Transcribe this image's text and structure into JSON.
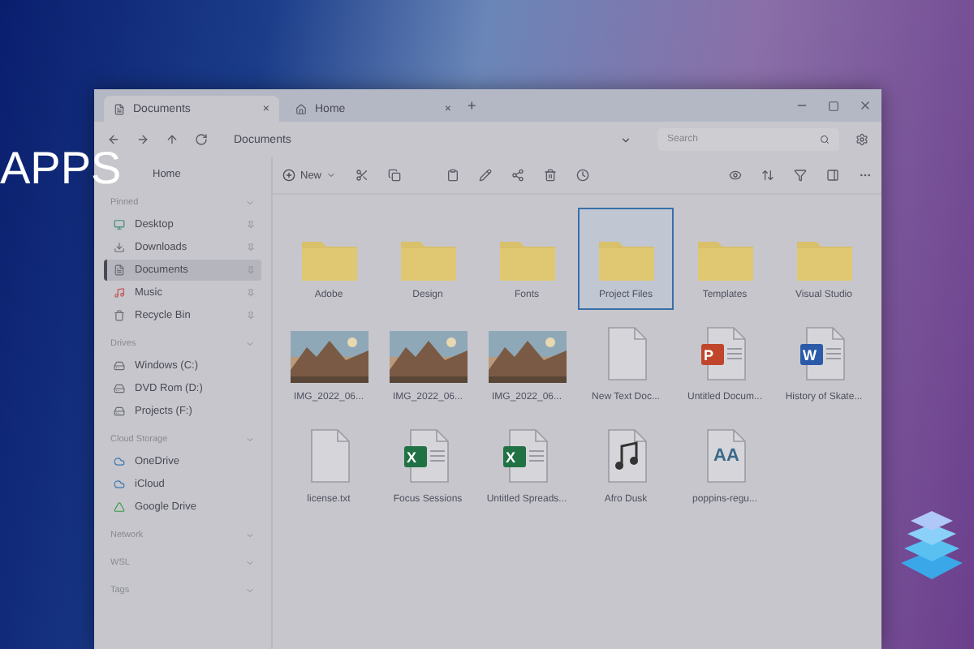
{
  "overlay": {
    "title": "APPS"
  },
  "tabs": [
    {
      "label": "Documents",
      "selected": true,
      "close": "×"
    },
    {
      "label": "Home",
      "selected": false,
      "close": "×"
    }
  ],
  "new_tab": "+",
  "address": {
    "path": "Documents",
    "search_placeholder": "Search"
  },
  "toolbar": {
    "new_label": "New"
  },
  "sidebar": [
    {
      "kind": "item",
      "label": "Home",
      "selected": false
    },
    {
      "kind": "section",
      "label": "Pinned"
    },
    {
      "kind": "item",
      "label": "Desktop",
      "selected": false,
      "pinned": true
    },
    {
      "kind": "item",
      "label": "Downloads",
      "selected": false,
      "pinned": true
    },
    {
      "kind": "item",
      "label": "Documents",
      "selected": true,
      "pinned": true
    },
    {
      "kind": "item",
      "label": "Music",
      "selected": false,
      "pinned": true
    },
    {
      "kind": "item",
      "label": "Recycle Bin",
      "selected": false,
      "pinned": true
    },
    {
      "kind": "section",
      "label": "Drives"
    },
    {
      "kind": "item",
      "label": "Windows (C:)",
      "selected": false
    },
    {
      "kind": "item",
      "label": "DVD Rom (D:)",
      "selected": false
    },
    {
      "kind": "item",
      "label": "Projects (F:)",
      "selected": false
    },
    {
      "kind": "section",
      "label": "Cloud Storage"
    },
    {
      "kind": "item",
      "label": "OneDrive",
      "selected": false
    },
    {
      "kind": "item",
      "label": "iCloud",
      "selected": false
    },
    {
      "kind": "item",
      "label": "Google Drive",
      "selected": false
    },
    {
      "kind": "section",
      "label": "Network"
    },
    {
      "kind": "section",
      "label": "WSL"
    },
    {
      "kind": "section",
      "label": "Tags"
    }
  ],
  "files": [
    {
      "kind": "folder",
      "name": "Adobe",
      "selected": false
    },
    {
      "kind": "folder",
      "name": "Design",
      "selected": false
    },
    {
      "kind": "folder",
      "name": "Fonts",
      "selected": false
    },
    {
      "kind": "folder",
      "name": "Project Files",
      "selected": true
    },
    {
      "kind": "folder",
      "name": "Templates",
      "selected": false
    },
    {
      "kind": "folder",
      "name": "Visual Studio",
      "selected": false
    },
    {
      "name": "IMG_2022_06...",
      "selected": false
    },
    {
      "name": "IMG_2022_06...",
      "selected": false
    },
    {
      "name": "IMG_2022_06...",
      "selected": false
    },
    {
      "kind": "text",
      "name": "New Text Doc...",
      "selected": false
    },
    {
      "kind": "powerpoint",
      "name": "Untitled Docum...",
      "badge": "P",
      "selected": false
    },
    {
      "kind": "word",
      "name": "History of Skate...",
      "badge": "W",
      "selected": false
    },
    {
      "kind": "text",
      "name": "license.txt",
      "selected": false
    },
    {
      "kind": "excel",
      "name": "Focus Sessions",
      "badge": "X",
      "selected": false
    },
    {
      "kind": "excel",
      "name": "Untitled Spreads...",
      "badge": "X",
      "selected": false
    },
    {
      "kind": "audio",
      "name": "Afro Dusk",
      "selected": false
    },
    {
      "kind": "font",
      "name": "poppins-regu...",
      "badge": "AA",
      "selected": false
    }
  ]
}
